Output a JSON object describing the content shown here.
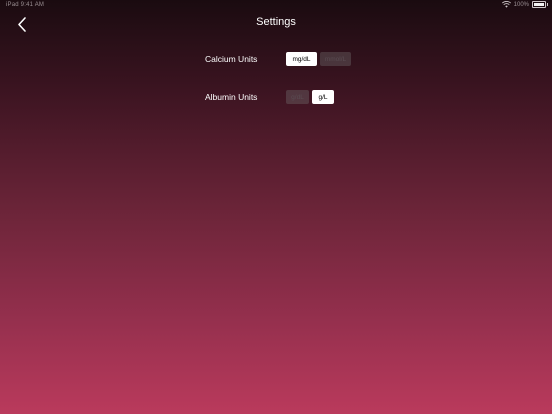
{
  "status_bar": {
    "left_text": "iPad  9:41 AM",
    "battery_text": "100%"
  },
  "nav": {
    "title": "Settings",
    "back_icon": "chevron-left-icon"
  },
  "settings": [
    {
      "label": "Calcium Units",
      "options": [
        "mg/dL",
        "mmol/L"
      ],
      "selected": "mg/dL"
    },
    {
      "label": "Albumin Units",
      "options": [
        "g/dL",
        "g/L"
      ],
      "selected": "g/L"
    }
  ],
  "colors": {
    "selected_bg": "#ffffff",
    "unselected_bg": "#4a3a40",
    "gradient_top": "#1a0b10",
    "gradient_bottom": "#ba3a5c"
  }
}
